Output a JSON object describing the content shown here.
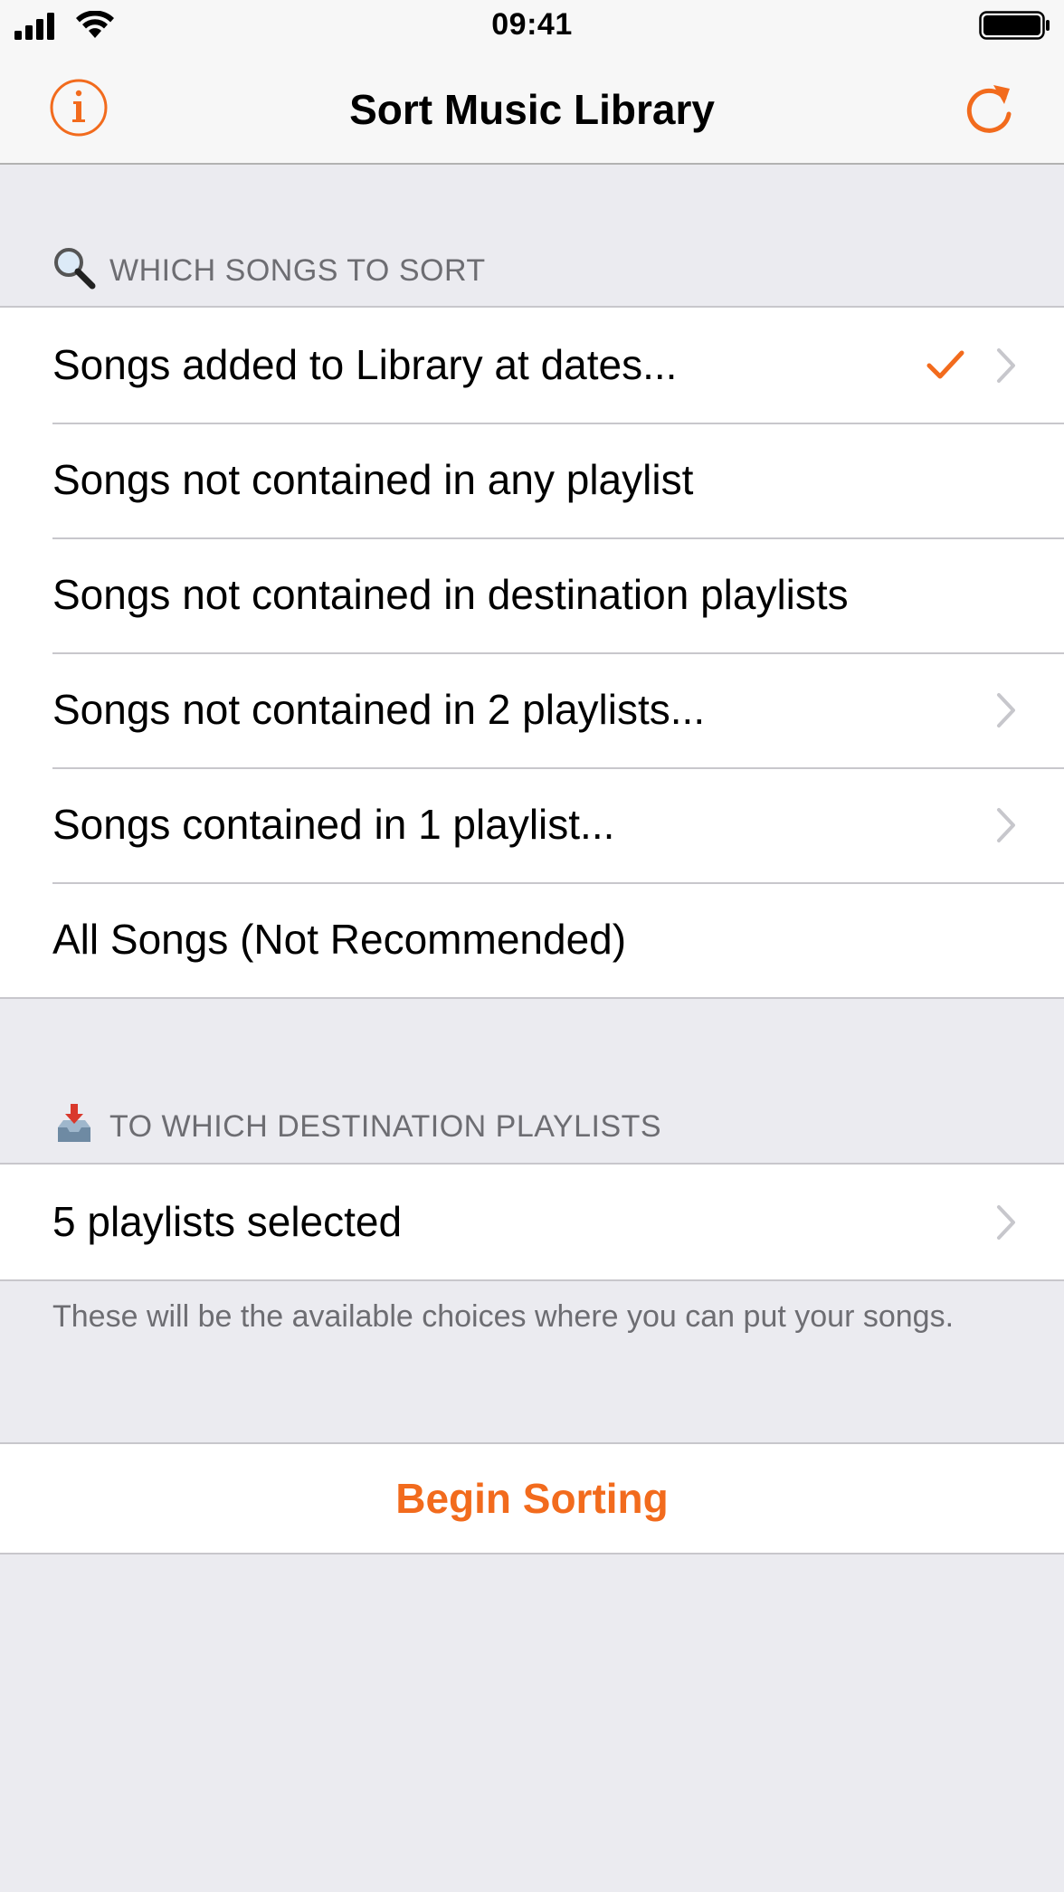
{
  "status_bar": {
    "time": "09:41",
    "icons": [
      "signal-icon",
      "wifi-icon",
      "battery-icon"
    ]
  },
  "nav": {
    "title": "Sort Music Library",
    "left_icon": "info-icon",
    "right_icon": "refresh-icon"
  },
  "accent_color": "#F26B1D",
  "section_songs": {
    "header": "WHICH SONGS TO SORT",
    "icon": "magnifier-icon",
    "rows": [
      {
        "label": "Songs added to Library at dates...",
        "checked": true,
        "chevron": true
      },
      {
        "label": "Songs not contained in any playlist",
        "checked": false,
        "chevron": false
      },
      {
        "label": "Songs not contained in destination playlists",
        "checked": false,
        "chevron": false
      },
      {
        "label": "Songs not contained in 2 playlists...",
        "checked": false,
        "chevron": true
      },
      {
        "label": "Songs contained in 1 playlist...",
        "checked": false,
        "chevron": true
      },
      {
        "label": "All Songs (Not Recommended)",
        "checked": false,
        "chevron": false
      }
    ]
  },
  "section_destination": {
    "header": "TO WHICH DESTINATION PLAYLISTS",
    "icon": "inbox-tray-icon",
    "rows": [
      {
        "label": "5 playlists selected",
        "chevron": true
      }
    ],
    "footer": "These will be the available choices where you can put your songs."
  },
  "action": {
    "label": "Begin Sorting"
  }
}
